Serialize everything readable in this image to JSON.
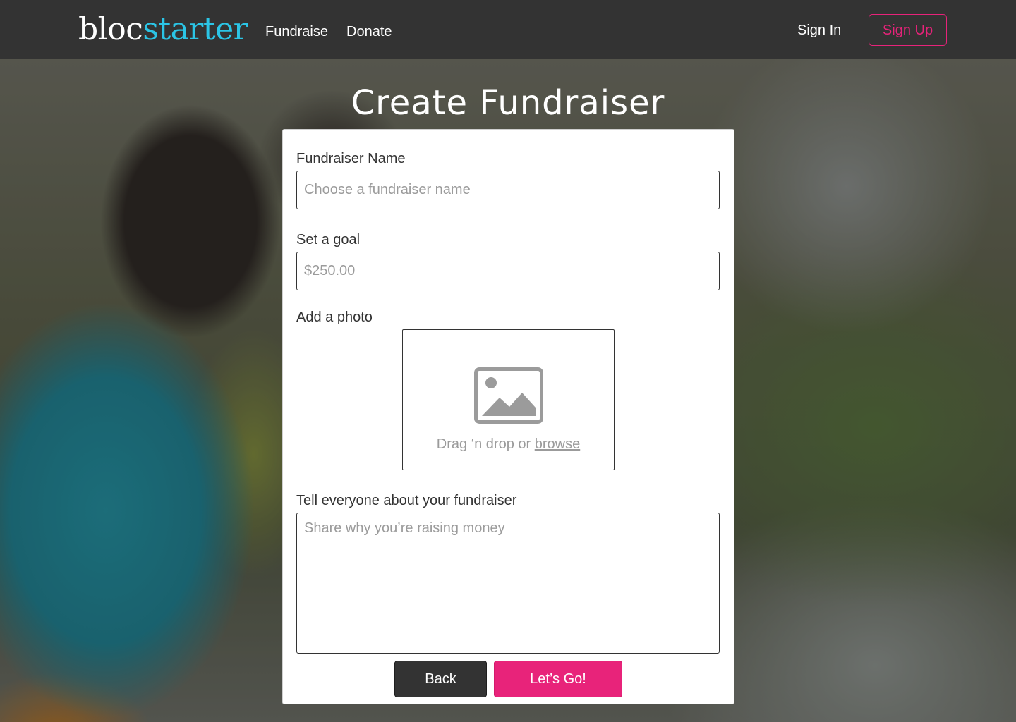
{
  "header": {
    "logo_part1": "bloc",
    "logo_part2": "starter",
    "nav": {
      "fundraise": "Fundraise",
      "donate": "Donate"
    },
    "sign_in": "Sign In",
    "sign_up": "Sign Up"
  },
  "page": {
    "title": "Create Fundraiser"
  },
  "form": {
    "name_label": "Fundraiser Name",
    "name_placeholder": "Choose a fundraiser name",
    "goal_label": "Set a goal",
    "goal_placeholder": "$250.00",
    "photo_label": "Add a photo",
    "drop_text": "Drag ‘n drop or ",
    "browse_text": "browse",
    "about_label": "Tell everyone about your fundraiser",
    "about_placeholder": "Share why you’re raising money",
    "back_button": "Back",
    "submit_button": "Let’s Go!"
  },
  "icons": {
    "photo": "image-placeholder-icon"
  },
  "colors": {
    "header_bg": "#333333",
    "brand_cyan": "#2bc5e6",
    "accent_pink": "#e8237a",
    "dark_button": "#333333",
    "muted_text": "#9b9b9b"
  }
}
